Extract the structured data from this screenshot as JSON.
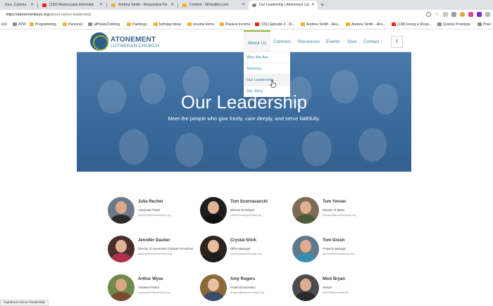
{
  "browser": {
    "tabs": [
      {
        "label": "Dice, Camera",
        "active": false
      },
      {
        "label": "(152) Música para informátic",
        "active": false
      },
      {
        "label": "Andrew Smith - Responsive Re",
        "active": false
      },
      {
        "label": "Content - 5thstudios.com",
        "active": false
      },
      {
        "label": "Our Leadership | Atonement Lut",
        "active": true
      }
    ],
    "new_tab": "+",
    "url_host": "https://atonementwyo.org",
    "url_path": "/about-us/our-leadership",
    "bookmarks": [
      "loO",
      "ATW",
      "Programming",
      "Personal",
      "allHuskyClothing",
      "Paintings",
      "birthday ideas",
      "resume items",
      "Passive Income",
      "(151) Episode 2 - Di...",
      "Andrew Smith - Res...",
      "Andrew Smith - Res...",
      "(138) Fixing a Shopi...",
      "Quickly Prototype",
      "Pixel"
    ]
  },
  "site": {
    "logo_line1": "ATONEMENT",
    "logo_line2": "LUTHERAN CHURCH",
    "nav": [
      "About Us",
      "Connect",
      "Resources",
      "Events",
      "Give",
      "Contact"
    ],
    "facebook": "f",
    "dropdown": [
      "Who We Are",
      "Services",
      "Our Leadership",
      "Our Story"
    ],
    "hero_title": "Our Leadership",
    "hero_subtitle": "Meet the people who give freely, care deeply, and serve faithfully."
  },
  "team": [
    {
      "name": "Julie Recher",
      "role": "Associate Pastor",
      "email": "jrecher@atonementwyo.org"
    },
    {
      "name": "Tom Scornavacchi",
      "role": "Mission Developer",
      "email": "pastortom@cgministry.org"
    },
    {
      "name": "Tom Yenser",
      "role": "Director of Music",
      "email": "tyenser@atonementwyo.org"
    },
    {
      "name": "Jennifer Dauber",
      "role": "Director of Atonement Christian Preschool",
      "email": "jdauber@atonementwyo.org"
    },
    {
      "name": "Crystal Shirk",
      "role": "Office Manager",
      "email": "cshirk@atonementwyo.org"
    },
    {
      "name": "Tom Gresh",
      "role": "Property Manager",
      "email": "tgresh@atonementwyo.org"
    },
    {
      "name": "Arthur Wyse",
      "role": "Visitation Pastor",
      "email": "awyse@atonementwyo.org"
    },
    {
      "name": "Amy Rogers",
      "role": "Financial Secretary",
      "email": "arogers@atonementwyo.org"
    },
    {
      "name": "Mick Bryan",
      "role": "Sexton",
      "email": "bob205@comcast.net"
    }
  ],
  "status_url": "org/about-us/our-leadership",
  "colors": {
    "brand_blue": "#2f5f86",
    "link_teal": "#2f86a0",
    "accent_green": "#8fb33b",
    "hero_overlay": "#3d6d9f"
  }
}
